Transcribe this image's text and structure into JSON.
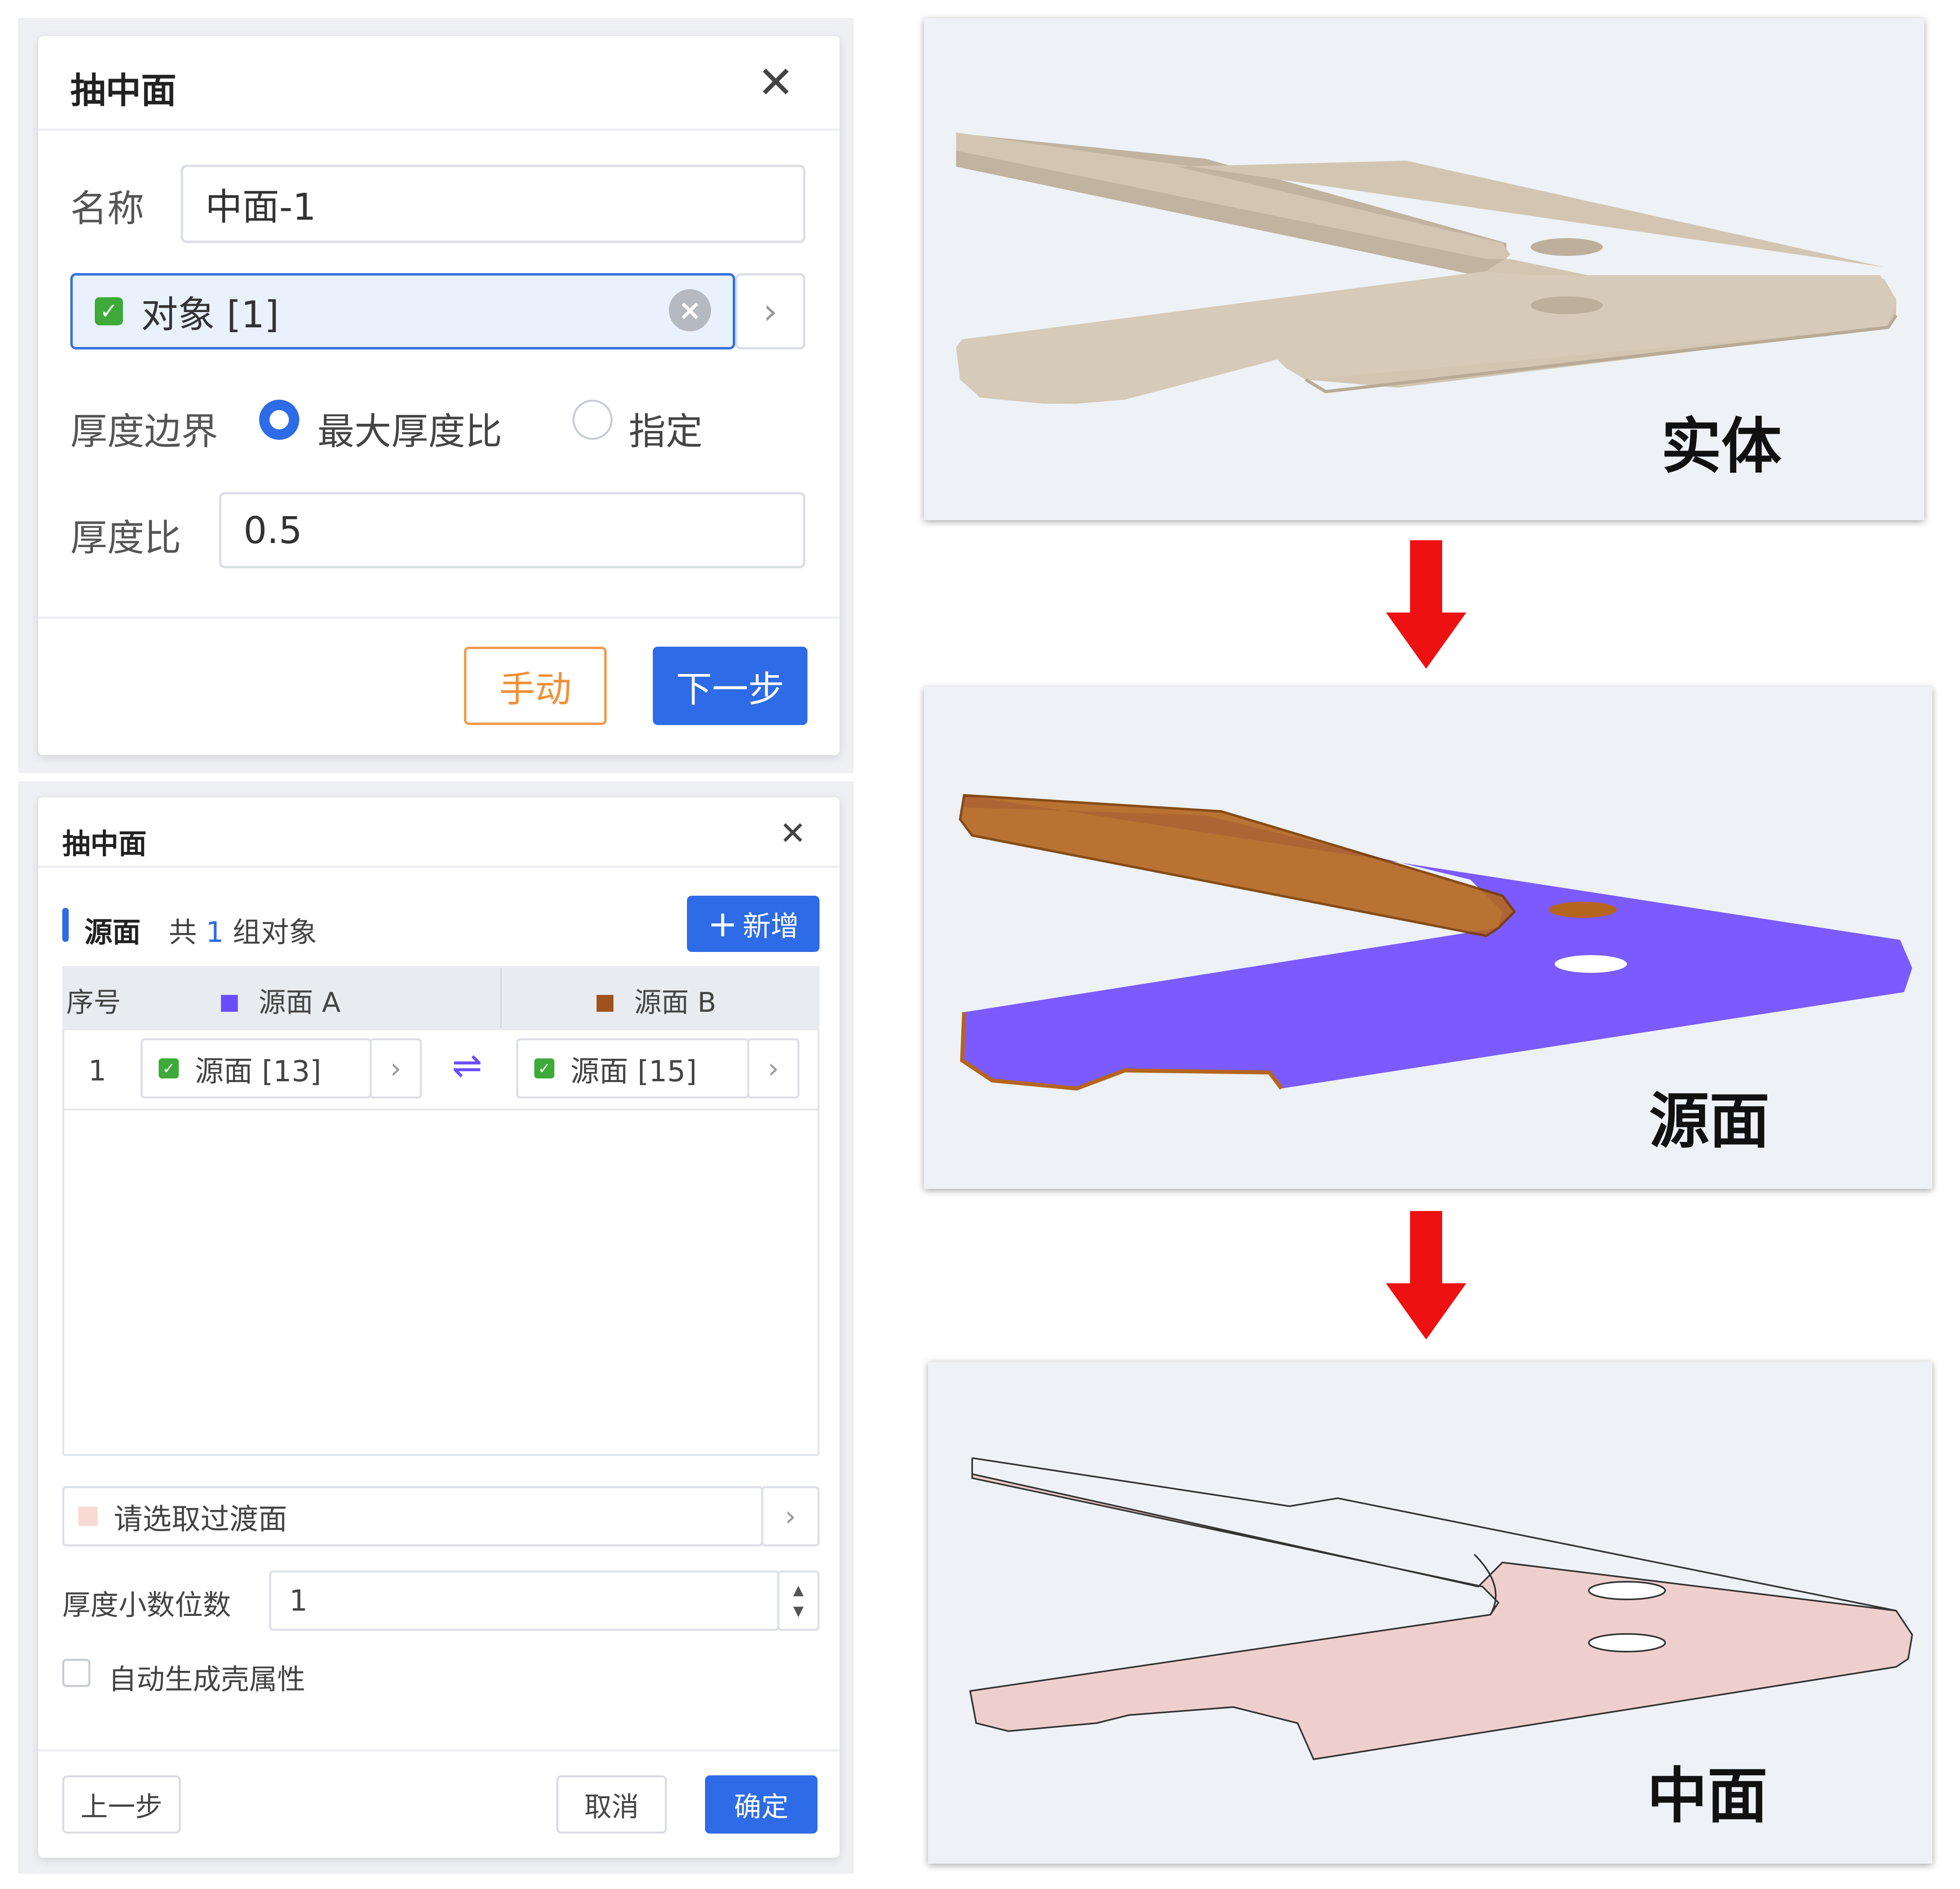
{
  "dialog1": {
    "title": "抽中面",
    "name_label": "名称",
    "name_value": "中面-1",
    "object_value": "对象 [1]",
    "thickness_boundary_label": "厚度边界",
    "option_max_ratio": "最大厚度比",
    "option_specified": "指定",
    "ratio_label": "厚度比",
    "ratio_value": "0.5",
    "manual_button": "手动",
    "next_button": "下一步"
  },
  "dialog2": {
    "title": "抽中面",
    "section_title": "源面",
    "group_prefix": "共",
    "group_count": "1",
    "group_suffix": "组对象",
    "add_button": "新增",
    "table": {
      "col_index": "序号",
      "col_a": "源面 A",
      "col_b": "源面 B",
      "rows": [
        {
          "index": "1",
          "a": "源面 [13]",
          "b": "源面 [15]"
        }
      ]
    },
    "transition_placeholder": "请选取过渡面",
    "decimal_label": "厚度小数位数",
    "decimal_value": "1",
    "auto_shell_label": "自动生成壳属性",
    "prev_button": "上一步",
    "cancel_button": "取消",
    "ok_button": "确定"
  },
  "views": {
    "solid_label": "实体",
    "source_label": "源面",
    "mid_label": "中面"
  },
  "colors": {
    "primary": "#2e6be6",
    "orange": "#f29a4a",
    "source_a": "#6a4dff",
    "source_b": "#a0521e",
    "arrow": "#ee1111",
    "solid_fill": "#d2c6b3",
    "mid_fill": "#efcfcd"
  },
  "icons": [
    "close-icon",
    "check-icon",
    "clear-icon",
    "chevron-right-icon",
    "plus-icon",
    "swap-icon",
    "spinner-up-icon",
    "spinner-down-icon",
    "arrow-down-icon"
  ]
}
